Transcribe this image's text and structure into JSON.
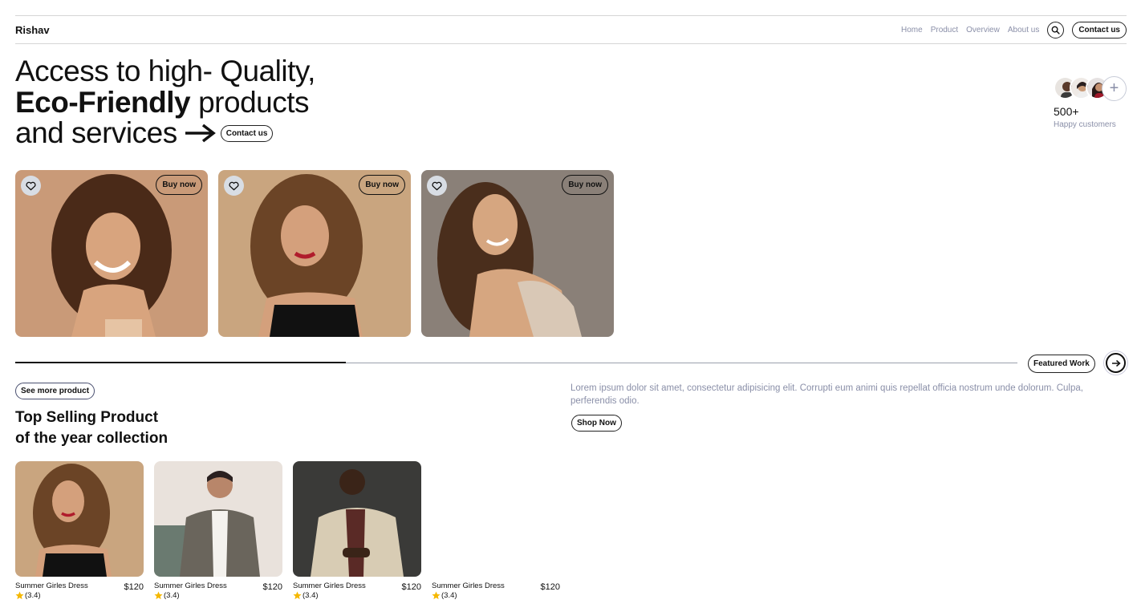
{
  "header": {
    "brand": "Rishav",
    "nav": [
      "Home",
      "Product",
      "Overview",
      "About us"
    ],
    "contact_label": "Contact us"
  },
  "hero": {
    "line1": "Access to high- Quality,",
    "line2_bold": "Eco-Friendly",
    "line2_rest": "products",
    "line3": "and services",
    "contact_label": "Contact us"
  },
  "customers": {
    "count": "500+",
    "label": "Happy customers"
  },
  "cards": [
    {
      "buy_label": "Buy now"
    },
    {
      "buy_label": "Buy now"
    },
    {
      "buy_label": "Buy now"
    }
  ],
  "slider": {
    "progress": 0.33,
    "featured_label": "Featured Work"
  },
  "top_selling": {
    "see_more_label": "See more product",
    "title_line1": "Top Selling Product",
    "title_line2": "of the year collection",
    "description": "Lorem ipsum dolor sit amet, consectetur adipisicing elit. Corrupti eum animi quis repellat officia nostrum unde dolorum. Culpa, perferendis odio.",
    "shop_now_label": "Shop Now"
  },
  "products": [
    {
      "name": "Summer Girles Dress",
      "price": "$120",
      "rating": "(3.4)"
    },
    {
      "name": "Summer Girles Dress",
      "price": "$120",
      "rating": "(3.4)"
    },
    {
      "name": "Summer Girles Dress",
      "price": "$120",
      "rating": "(3.4)"
    },
    {
      "name": "Summer Girles Dress",
      "price": "$120",
      "rating": "(3.4)"
    }
  ],
  "colors": {
    "muted_text": "#8a8fa8",
    "star": "#f5b800",
    "card1_bg": "#c99a78",
    "card2_bg": "#c9a57f",
    "card3_bg": "#8a8078"
  }
}
